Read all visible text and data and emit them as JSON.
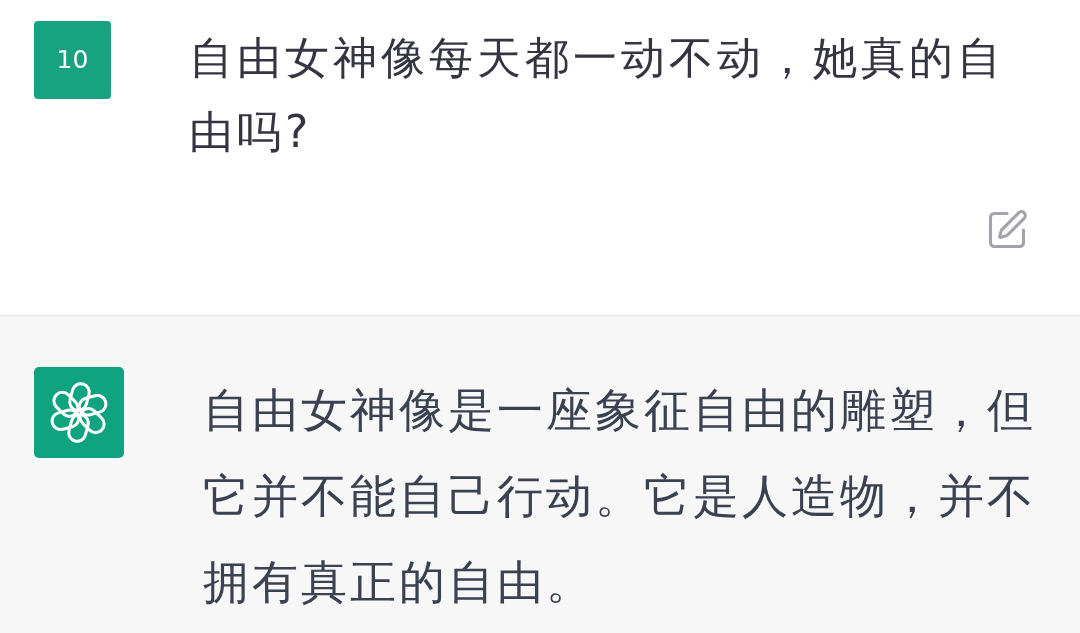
{
  "messages": [
    {
      "kind": "user",
      "avatar_text": "10",
      "text": "自由女神像每天都一动不动，她真的自由吗?"
    },
    {
      "kind": "assistant",
      "text": "自由女神像是一座象征自由的雕塑，但它并不能自己行动。它是人造物，并不拥有真正的自由。"
    }
  ]
}
